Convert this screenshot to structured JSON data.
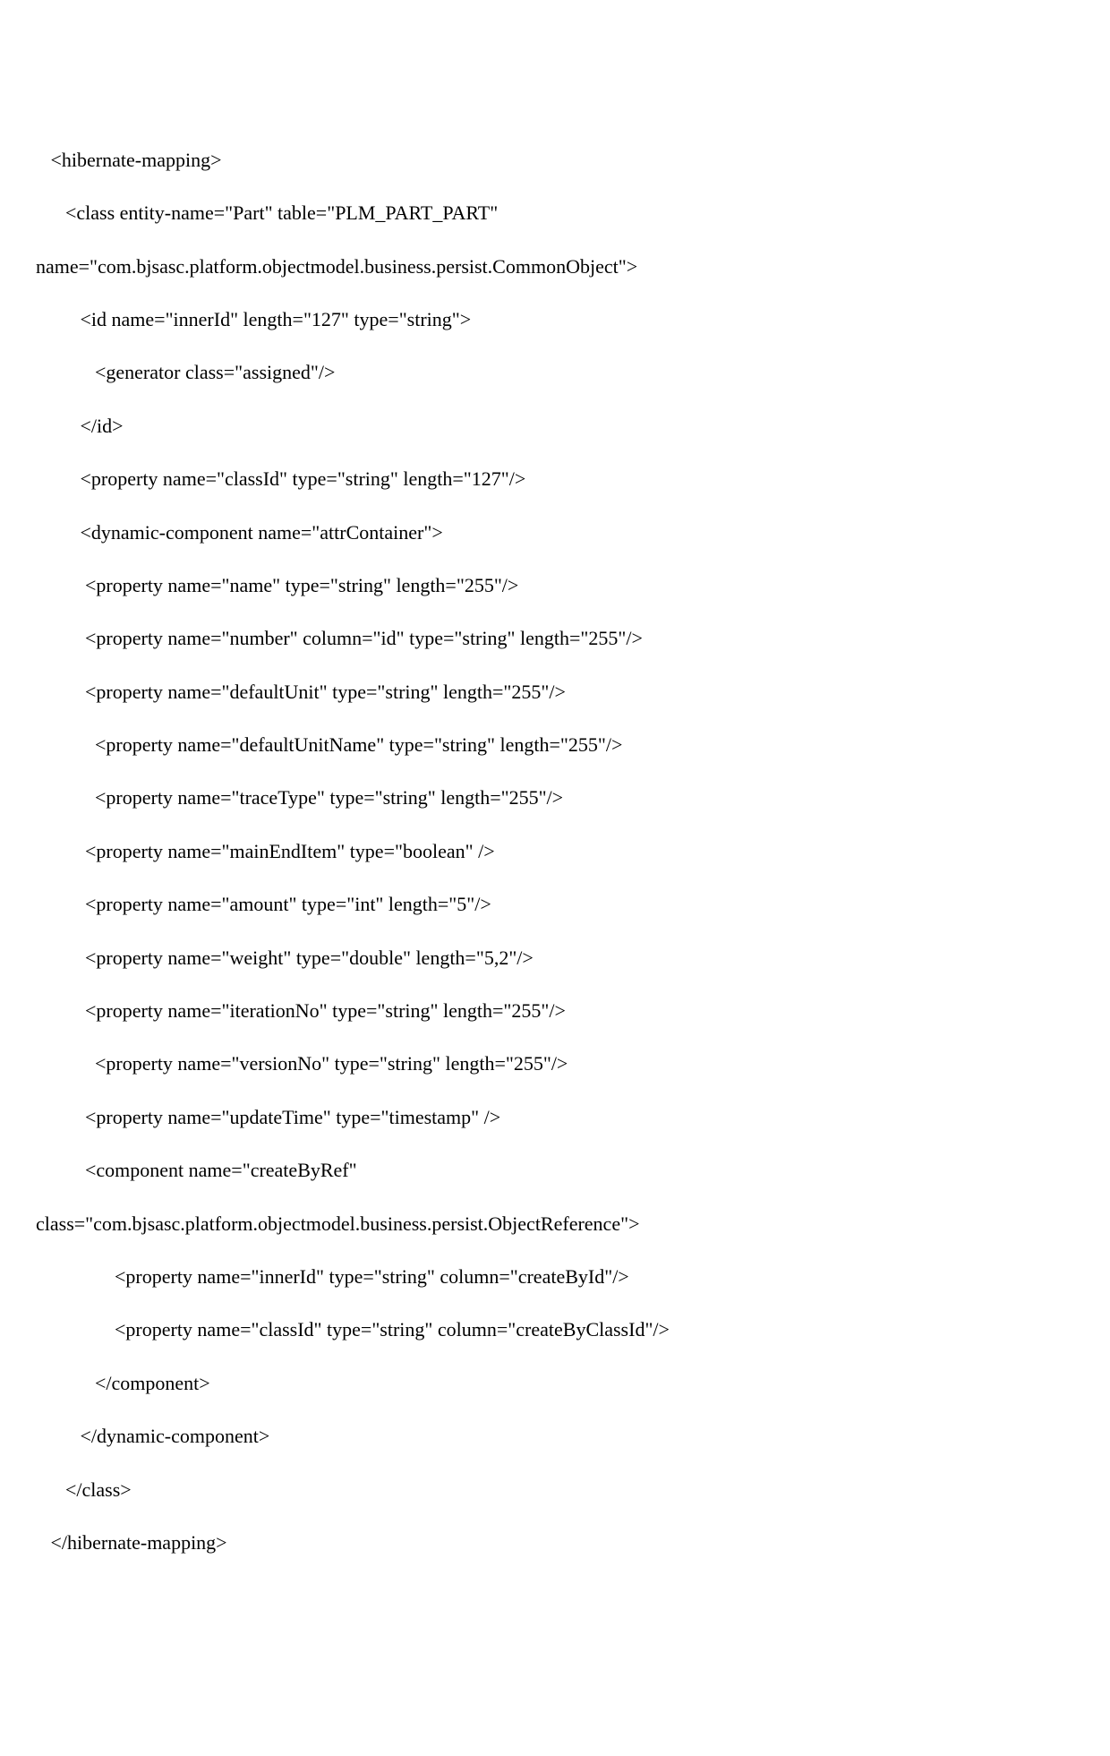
{
  "lines": [
    "   <hibernate-mapping>",
    "      <class entity-name=\"Part\" table=\"PLM_PART_PART\"",
    "name=\"com.bjsasc.platform.objectmodel.business.persist.CommonObject\">",
    "         <id name=\"innerId\" length=\"127\" type=\"string\">",
    "            <generator class=\"assigned\"/>",
    "         </id>",
    "         <property name=\"classId\" type=\"string\" length=\"127\"/>",
    "         <dynamic-component name=\"attrContainer\">",
    "          <property name=\"name\" type=\"string\" length=\"255\"/>",
    "          <property name=\"number\" column=\"id\" type=\"string\" length=\"255\"/>",
    "          <property name=\"defaultUnit\" type=\"string\" length=\"255\"/>",
    "            <property name=\"defaultUnitName\" type=\"string\" length=\"255\"/>",
    "            <property name=\"traceType\" type=\"string\" length=\"255\"/>",
    "          <property name=\"mainEndItem\" type=\"boolean\" />",
    "          <property name=\"amount\" type=\"int\" length=\"5\"/>",
    "          <property name=\"weight\" type=\"double\" length=\"5,2\"/>",
    "          <property name=\"iterationNo\" type=\"string\" length=\"255\"/>",
    "            <property name=\"versionNo\" type=\"string\" length=\"255\"/>",
    "          <property name=\"updateTime\" type=\"timestamp\" />",
    "          <component name=\"createByRef\"",
    "class=\"com.bjsasc.platform.objectmodel.business.persist.ObjectReference\">",
    "                <property name=\"innerId\" type=\"string\" column=\"createById\"/>",
    "                <property name=\"classId\" type=\"string\" column=\"createByClassId\"/>",
    "            </component>",
    "         </dynamic-component>",
    "      </class>",
    "   </hibernate-mapping>"
  ]
}
